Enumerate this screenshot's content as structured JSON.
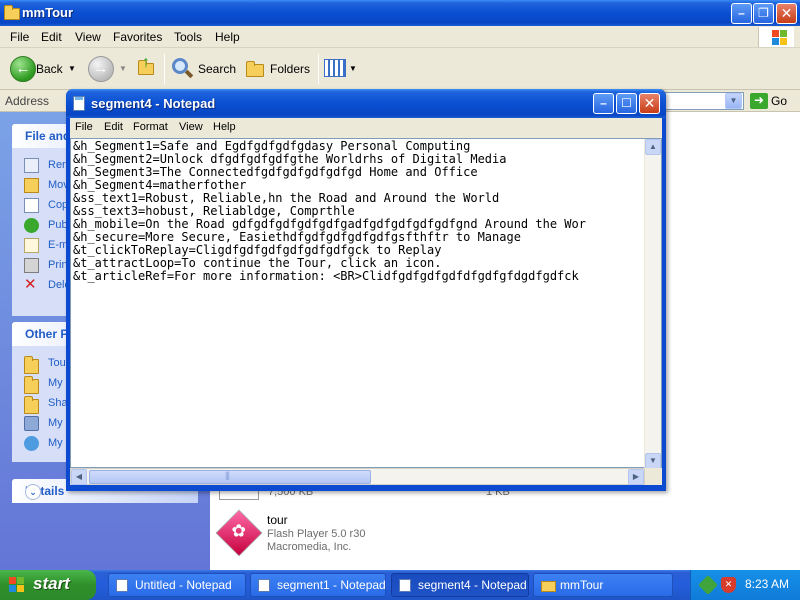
{
  "explorer": {
    "title": "mmTour",
    "menu": [
      "File",
      "Edit",
      "View",
      "Favorites",
      "Tools",
      "Help"
    ],
    "toolbar": {
      "back_label": "Back",
      "search_label": "Search",
      "folders_label": "Folders"
    },
    "address_label": "Address",
    "go_label": "Go",
    "task_pane": {
      "file_tasks_title": "File and",
      "file_tasks": [
        "Ren",
        "Mov",
        "Cop",
        "Pub",
        "E-m",
        "Prin",
        "Dele"
      ],
      "other_places_title": "Other P",
      "other_places": [
        "Tou",
        "My",
        "Sha",
        "My",
        "My"
      ],
      "details_title": "Details"
    },
    "files": {
      "size1": "7,500 KB",
      "size2": "1 KB",
      "tile": {
        "name": "tour",
        "type": "Flash Player 5.0 r30",
        "company": "Macromedia, Inc."
      }
    }
  },
  "notepad": {
    "title": "segment4 - Notepad",
    "menu": [
      "File",
      "Edit",
      "Format",
      "View",
      "Help"
    ],
    "lines": [
      "&h_Segment1=Safe and Egdfgdfgdfgdasy Personal Computing",
      "&h_Segment2=Unlock dfgdfgdfgdfgthe Worldrhs of Digital Media",
      "&h_Segment3=The Connectedfgdfgdfgdfgdfgd Home and Office",
      "&h_Segment4=matherfother",
      "&ss_text1=Robust, Reliable,hn the Road and Around the World",
      "&ss_text3=hobust, Reliabldge, Comprthle",
      "&h_mobile=On the Road gdfgdfgdfgdfgdfgadfgdfgdfgdfgdfgnd Around the Wor",
      "&h_secure=More Secure, Easiethdfgdfgdfgdfgdfgsfthftr to Manage",
      "&t_clickToReplay=Cligdfgdfgdfgdfgdfgdfgck to Replay",
      "&t_attractLoop=To continue the Tour, click an icon.",
      "&t_articleRef=For more information: <BR>Clidfgdfgdfgdfdfgdfgfdgdfgdfck"
    ]
  },
  "taskbar": {
    "start_label": "start",
    "tasks": [
      {
        "label": "Untitled - Notepad"
      },
      {
        "label": "segment1 - Notepad"
      },
      {
        "label": "segment4 - Notepad"
      },
      {
        "label": "mmTour"
      }
    ],
    "clock": "8:23 AM"
  }
}
